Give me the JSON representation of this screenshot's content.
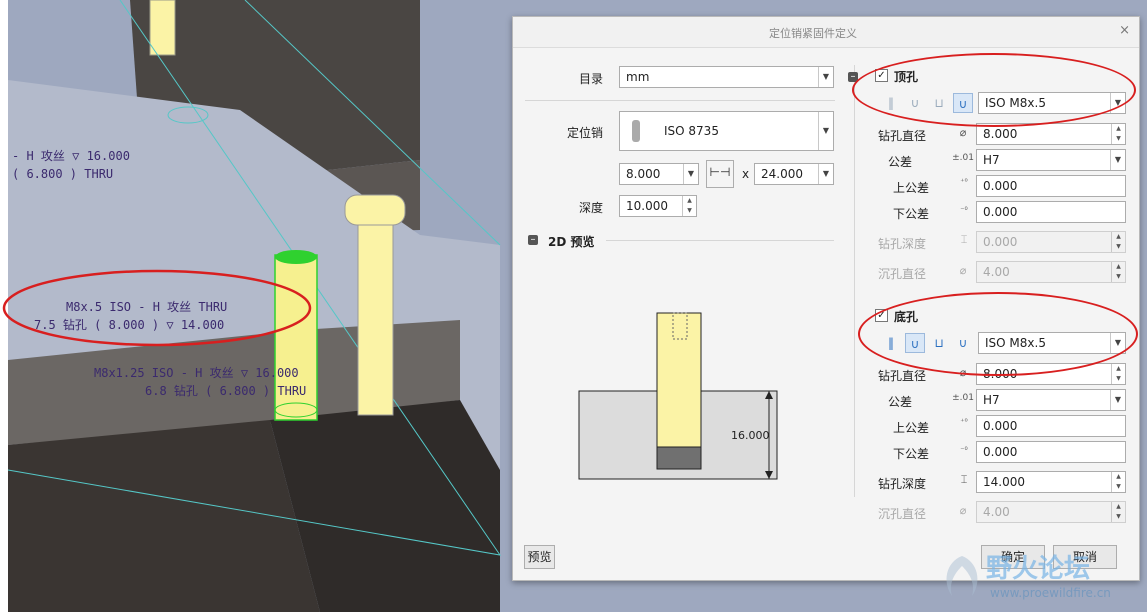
{
  "cad": {
    "note1_line1": "- H 攻丝 ▽ 16.000",
    "note1_line2": "( 6.800 ) THRU",
    "note2_line1": "M8x.5 ISO - H 攻丝  THRU",
    "note2_line2": "7.5 钻孔 ( 8.000 ) ▽ 14.000",
    "note3_line1": "M8x1.25 ISO - H 攻丝  ▽ 16.000",
    "note3_line2": "6.8 钻孔 ( 6.800 ) THRU"
  },
  "dialog": {
    "title": "定位销紧固件定义",
    "close_glyph": "×",
    "catalog_label": "目录",
    "catalog_value": "mm",
    "pin_label": "定位销",
    "pin_value": "ISO 8735",
    "diameter_value": "8.000",
    "times_glyph": "x",
    "length_value": "24.000",
    "depth_label": "深度",
    "depth_value": "10.000",
    "preview_section": "2D 预览",
    "preview_dimension": "16.000",
    "preview_button": "预览",
    "ok_button": "确定",
    "cancel_button": "取消"
  },
  "top_hole": {
    "checked": true,
    "label": "顶孔",
    "thread": "ISO M8x.5",
    "drill_diameter_label": "钻孔直径",
    "drill_diameter": "8.000",
    "tolerance_label": "公差",
    "tolerance_prefix": "±.01",
    "tolerance": "H7",
    "upper_label": "上公差",
    "upper": "0.000",
    "lower_label": "下公差",
    "lower": "0.000",
    "depth_label": "钻孔深度",
    "depth": "0.000",
    "counterbore_label": "沉孔直径",
    "counterbore": "4.00"
  },
  "bottom_hole": {
    "checked": true,
    "label": "底孔",
    "thread": "ISO M8x.5",
    "drill_diameter_label": "钻孔直径",
    "drill_diameter": "8.000",
    "tolerance_label": "公差",
    "tolerance_prefix": "±.01",
    "tolerance": "H7",
    "upper_label": "上公差",
    "upper": "0.000",
    "lower_label": "下公差",
    "lower": "0.000",
    "depth_label": "钻孔深度",
    "depth": "14.000",
    "counterbore_label": "沉孔直径",
    "counterbore": "4.00"
  },
  "watermark": {
    "name": "野火论坛",
    "url": "www.proewildfire.cn"
  },
  "colors": {
    "annotation_red": "#d81f1f",
    "pin_yellow": "#fbf3a6",
    "pin_green": "#2fd12f",
    "model_dark": "#3a3532",
    "model_surface": "#9aa3b8"
  }
}
